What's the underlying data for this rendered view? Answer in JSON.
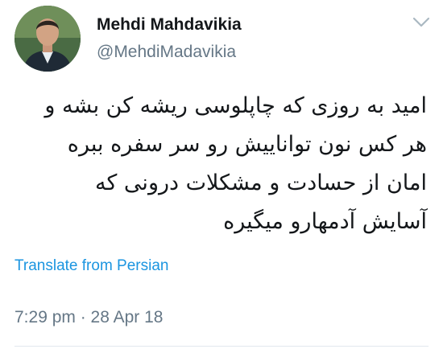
{
  "author": {
    "display_name": "Mehdi Mahdavikia",
    "handle": "@MehdiMadavikia",
    "avatar_icon": "profile-photo"
  },
  "tweet": {
    "lines": [
      "امید به روزی که چاپلوسی ریشه کن بشه و",
      "هر کس نون تواناییش رو سر سفره ببره",
      "امان از حسادت و مشکلات درونی که",
      "آسایش آدمهارو میگیره"
    ],
    "translate_label": "Translate from Persian",
    "timestamp": "7:29 pm · 28 Apr 18"
  },
  "colors": {
    "link": "#1b95e0",
    "secondary_text": "#657786",
    "primary_text": "#14171a"
  },
  "menu_icon": "chevron-down-icon"
}
